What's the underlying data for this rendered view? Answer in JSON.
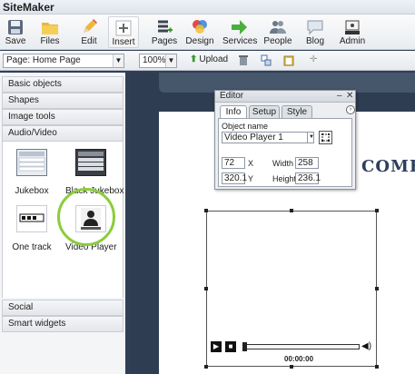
{
  "app": {
    "title": "SiteMaker"
  },
  "toolbar": {
    "items": [
      {
        "label": "Save",
        "icon": "save-icon"
      },
      {
        "label": "Files",
        "icon": "folder-icon"
      },
      {
        "label": "Edit",
        "icon": "pencil-icon"
      },
      {
        "label": "Insert",
        "icon": "insert-plus-icon"
      },
      {
        "label": "Pages",
        "icon": "pages-icon"
      },
      {
        "label": "Design",
        "icon": "design-color-icon"
      },
      {
        "label": "Services",
        "icon": "services-arrow-icon"
      },
      {
        "label": "People",
        "icon": "people-icon"
      },
      {
        "label": "Blog",
        "icon": "blog-speech-icon"
      },
      {
        "label": "Admin",
        "icon": "admin-icon"
      }
    ],
    "active": "Insert"
  },
  "toolbar2": {
    "page_select": "Page: Home Page",
    "zoom_select": "100%",
    "upload_label": "Upload"
  },
  "panel": {
    "sections_top": [
      "Basic objects",
      "Shapes",
      "Image tools",
      "Audio/Video"
    ],
    "tiles": [
      {
        "label": "Jukebox"
      },
      {
        "label": "Black Jukebox"
      },
      {
        "label": "One track"
      },
      {
        "label": "Video Player"
      }
    ],
    "sections_bottom": [
      "Social",
      "Smart widgets"
    ]
  },
  "canvas": {
    "welcome_text": "COME",
    "time": "00:00:00"
  },
  "editor": {
    "title": "Editor",
    "tabs": [
      "Info",
      "Setup",
      "Style"
    ],
    "active_tab": "Info",
    "object_name_label": "Object name",
    "object_name": "Video Player 1",
    "x_label": "X",
    "y_label": "Y",
    "width_label": "Width",
    "height_label": "Height",
    "x": "72",
    "y": "320.1",
    "width": "258",
    "height": "236.1"
  },
  "colors": {
    "accent_highlight": "#8ccc3a",
    "canvas_bg": "#2e3d52",
    "welcome_text": "#2c3f5f"
  }
}
